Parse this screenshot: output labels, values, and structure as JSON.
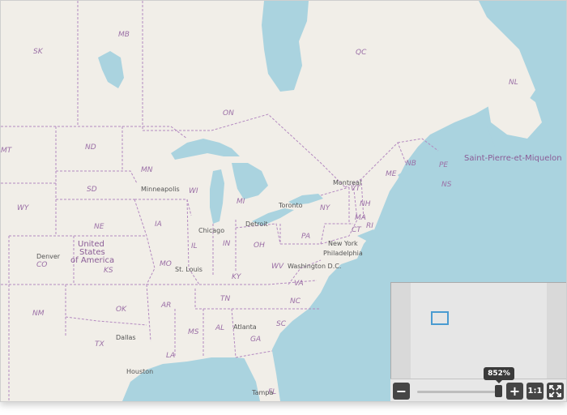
{
  "map": {
    "land_color": "#f1eee8",
    "water_color": "#aad3df",
    "border_color": "#b48ac0",
    "states": [
      {
        "label": "SK"
      },
      {
        "label": "MB"
      },
      {
        "label": "ON"
      },
      {
        "label": "QC"
      },
      {
        "label": "NL"
      },
      {
        "label": "MT"
      },
      {
        "label": "ND"
      },
      {
        "label": "MN"
      },
      {
        "label": "WY"
      },
      {
        "label": "SD"
      },
      {
        "label": "WI"
      },
      {
        "label": "MI"
      },
      {
        "label": "NE"
      },
      {
        "label": "IA"
      },
      {
        "label": "CO"
      },
      {
        "label": "KS"
      },
      {
        "label": "MO"
      },
      {
        "label": "IL"
      },
      {
        "label": "IN"
      },
      {
        "label": "OH"
      },
      {
        "label": "NM"
      },
      {
        "label": "OK"
      },
      {
        "label": "AR"
      },
      {
        "label": "KY"
      },
      {
        "label": "WV"
      },
      {
        "label": "TX"
      },
      {
        "label": "MS"
      },
      {
        "label": "AL"
      },
      {
        "label": "GA"
      },
      {
        "label": "TN"
      },
      {
        "label": "NC"
      },
      {
        "label": "SC"
      },
      {
        "label": "VA"
      },
      {
        "label": "LA"
      },
      {
        "label": "FL"
      },
      {
        "label": "PA"
      },
      {
        "label": "NY"
      },
      {
        "label": "VT"
      },
      {
        "label": "NH"
      },
      {
        "label": "ME"
      },
      {
        "label": "MA"
      },
      {
        "label": "CT"
      },
      {
        "label": "RI"
      },
      {
        "label": "NB"
      },
      {
        "label": "PE"
      },
      {
        "label": "NS"
      }
    ],
    "cities": [
      {
        "label": "Minneapolis"
      },
      {
        "label": "Chicago"
      },
      {
        "label": "Detroit"
      },
      {
        "label": "Toronto"
      },
      {
        "label": "Montreal"
      },
      {
        "label": "New York"
      },
      {
        "label": "Philadelphia"
      },
      {
        "label": "Washington D.C."
      },
      {
        "label": "Denver"
      },
      {
        "label": "St. Louis"
      },
      {
        "label": "Dallas"
      },
      {
        "label": "Houston"
      },
      {
        "label": "Atlanta"
      },
      {
        "label": "Tampa"
      }
    ],
    "countries": [
      {
        "label": "United"
      },
      {
        "label": "States"
      },
      {
        "label": "of America"
      },
      {
        "label": "Saint-Pierre-et-Miquelon"
      }
    ]
  },
  "controls": {
    "zoom_percent": "852%",
    "zoom_out_label": "−",
    "zoom_in_label": "+",
    "actual_size_label": "1:1",
    "fullscreen_icon": "fullscreen-icon"
  }
}
